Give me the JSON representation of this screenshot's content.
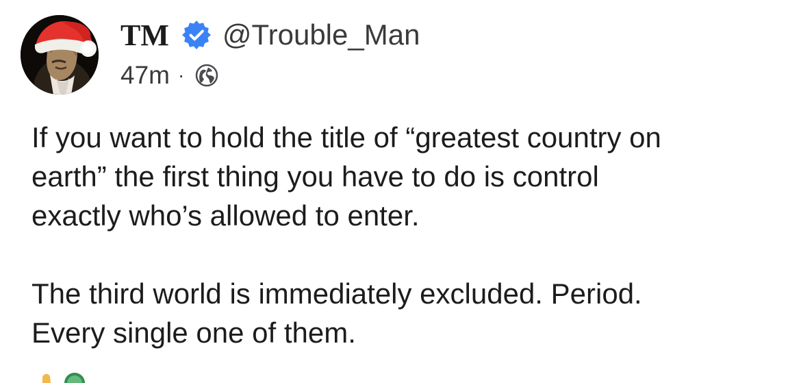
{
  "post": {
    "author": {
      "display_name": "TM",
      "handle": "@Trouble_Man",
      "verified": true,
      "avatar": "avatar"
    },
    "meta": {
      "time": "47m",
      "separator": "·",
      "visibility_icon": "globe-icon"
    },
    "body": {
      "paragraphs": [
        "If you want to hold the title of “greatest country on\nearth” the first thing you have to do is control\nexactly who’s allowed to enter.",
        "The third world is immediately excluded. Period.\nEvery single one of them."
      ]
    }
  },
  "colors": {
    "text": "#1c1c1e",
    "secondary": "#3a3a3c",
    "verified": "#3b82f6",
    "background": "#ffffff"
  },
  "icons": {
    "verified": "verified-badge-icon",
    "visibility": "globe-icon"
  }
}
